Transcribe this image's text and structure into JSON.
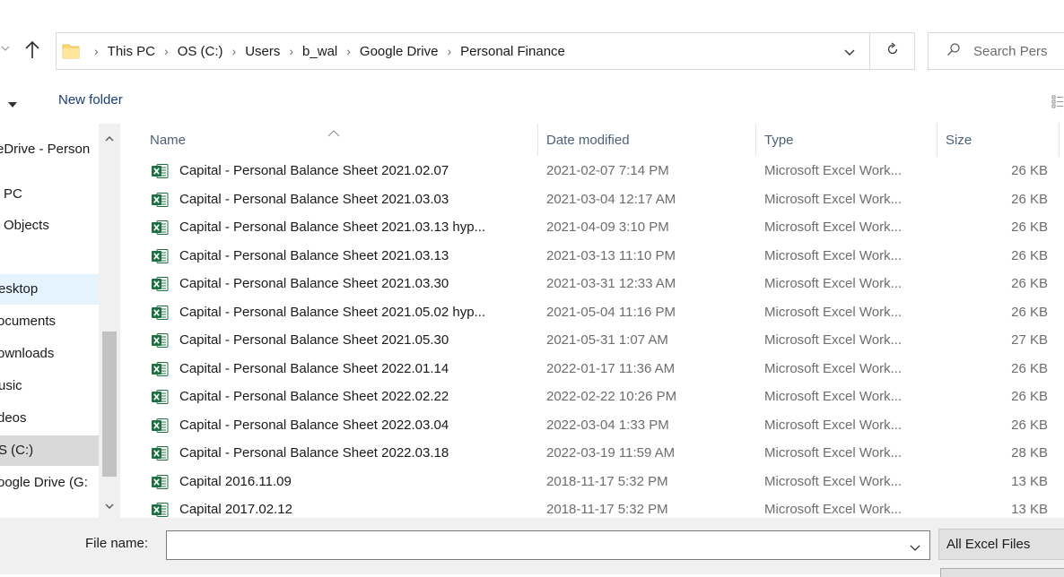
{
  "address": {
    "crumbs": [
      "This PC",
      "OS (C:)",
      "Users",
      "b_wal",
      "Google Drive",
      "Personal Finance"
    ],
    "search_placeholder": "Search Pers"
  },
  "toolbar": {
    "new_folder_label": "New folder"
  },
  "sidebar": {
    "items": [
      {
        "label": "eDrive - Person",
        "state": "normal"
      },
      {
        "label": "PC",
        "state": "normal"
      },
      {
        "label": "Objects",
        "state": "normal"
      },
      {
        "label": "",
        "state": "normal"
      },
      {
        "label": "esktop",
        "state": "hover"
      },
      {
        "label": "ocuments",
        "state": "normal"
      },
      {
        "label": "ownloads",
        "state": "normal"
      },
      {
        "label": "usic",
        "state": "normal"
      },
      {
        "label": "deos",
        "state": "normal"
      },
      {
        "label": "S (C:)",
        "state": "selected"
      },
      {
        "label": "oogle Drive (G:",
        "state": "normal"
      }
    ]
  },
  "file_list": {
    "columns": [
      "Name",
      "Date modified",
      "Type",
      "Size"
    ],
    "rows": [
      {
        "name": "Capital - Personal Balance Sheet 2021.02.07",
        "date": "2021-02-07 7:14 PM",
        "type": "Microsoft Excel Work...",
        "size": "26 KB"
      },
      {
        "name": "Capital - Personal Balance Sheet 2021.03.03",
        "date": "2021-03-04 12:17 AM",
        "type": "Microsoft Excel Work...",
        "size": "26 KB"
      },
      {
        "name": "Capital - Personal Balance Sheet 2021.03.13 hyp...",
        "date": "2021-04-09 3:10 PM",
        "type": "Microsoft Excel Work...",
        "size": "26 KB"
      },
      {
        "name": "Capital - Personal Balance Sheet 2021.03.13",
        "date": "2021-03-13 11:10 PM",
        "type": "Microsoft Excel Work...",
        "size": "26 KB"
      },
      {
        "name": "Capital - Personal Balance Sheet 2021.03.30",
        "date": "2021-03-31 12:33 AM",
        "type": "Microsoft Excel Work...",
        "size": "26 KB"
      },
      {
        "name": "Capital - Personal Balance Sheet 2021.05.02 hyp...",
        "date": "2021-05-04 11:16 PM",
        "type": "Microsoft Excel Work...",
        "size": "26 KB"
      },
      {
        "name": "Capital - Personal Balance Sheet 2021.05.30",
        "date": "2021-05-31 1:07 AM",
        "type": "Microsoft Excel Work...",
        "size": "27 KB"
      },
      {
        "name": "Capital - Personal Balance Sheet 2022.01.14",
        "date": "2022-01-17 11:36 AM",
        "type": "Microsoft Excel Work...",
        "size": "26 KB"
      },
      {
        "name": "Capital - Personal Balance Sheet 2022.02.22",
        "date": "2022-02-22 10:26 PM",
        "type": "Microsoft Excel Work...",
        "size": "26 KB"
      },
      {
        "name": "Capital - Personal Balance Sheet 2022.03.04",
        "date": "2022-03-04 1:33 PM",
        "type": "Microsoft Excel Work...",
        "size": "26 KB"
      },
      {
        "name": "Capital - Personal Balance Sheet 2022.03.18",
        "date": "2022-03-19 11:59 AM",
        "type": "Microsoft Excel Work...",
        "size": "28 KB"
      },
      {
        "name": "Capital 2016.11.09",
        "date": "2018-11-17 5:32 PM",
        "type": "Microsoft Excel Work...",
        "size": "13 KB"
      },
      {
        "name": "Capital 2017.02.12",
        "date": "2018-11-17 5:32 PM",
        "type": "Microsoft Excel Work...",
        "size": "13 KB"
      }
    ]
  },
  "bottom": {
    "filename_label": "File name:",
    "filename_value": "",
    "filter_label": "All Excel Files"
  },
  "icons": {
    "folder": "folder-icon",
    "excel_file": "excel-file-icon",
    "search": "search-icon",
    "refresh": "refresh-icon"
  },
  "colors": {
    "excel_green": "#1d6f42",
    "folder_yellow": "#f8d775",
    "hover_blue": "#e5f3ff",
    "header_text": "#4c607a"
  }
}
